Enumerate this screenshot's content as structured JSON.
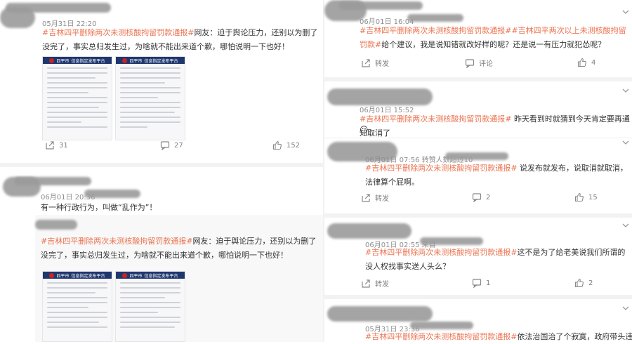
{
  "hashtag": "#吉林四平删除两次未测核酸拘留罚款通报#",
  "left": {
    "post1": {
      "time": "05月31日 22:20",
      "body": "网友：迫于舆论压力，还别以为删了没完了，事实总归发生过，为啥就不能出来道个歉，哪怕说明一下也好！",
      "doc_title_a": "四平市",
      "doc_title_b": "信息指定发布平台",
      "repost": "31",
      "comment": "27",
      "like": "152"
    },
    "post2": {
      "time": "06月01日 20:36",
      "body": "有一种行政行为，叫做“乱作为”！",
      "quoted_body": "网友：迫于舆论压力，还别以为删了没完了，事实总归发生过，为啥就不能出来道个歉，哪怕说明一下也好！",
      "doc_title_a": "四平市",
      "doc_title_b": "信息指定发布平台"
    }
  },
  "right": {
    "r1": {
      "time": "06月01日 16:04",
      "hashtag2": "#吉林四平两次以上未测核酸拘留罚款#",
      "body": "给个建议，我是说知错就改好样的呢？还是说一有压力就犯怂呢？",
      "repost_label": "转发",
      "comment_label": "评论",
      "like": "4"
    },
    "r2": {
      "time": "06月01日 15:52",
      "body": "昨天看到时就猜到今天肯定要再通知取消了",
      "emoji": "😶"
    },
    "r3": {
      "time": "06月01日 07:56 转赞人数超过10",
      "body": "说发布就发布，说取消就取消，法律算个屁啊。",
      "repost_label": "转发",
      "comment": "2",
      "like": "15"
    },
    "r4": {
      "time": "06月01日 02:55 来自",
      "body": "这不是为了给老美说我们所谓的没人权找事实送人头么？",
      "repost_label": "转发",
      "comment": "1",
      "like": "2"
    },
    "r5": {
      "time": "05月31日 23:36",
      "body": "依法治国治了个寂寞，政府带头违法",
      "emoji": "😓"
    }
  }
}
